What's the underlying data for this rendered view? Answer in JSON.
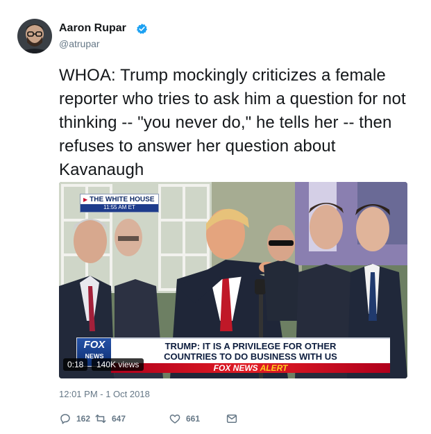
{
  "author": {
    "name": "Aaron Rupar",
    "handle": "@atrupar",
    "verified": true
  },
  "tweet": {
    "text": "WHOA: Trump mockingly criticizes a female reporter who tries to ask him a question for not thinking -- \"you never do,\" he tells her -- then refuses to answer her question about Kavanaugh",
    "timestamp": "12:01 PM - 1 Oct 2018"
  },
  "video": {
    "badge_title": "THE WHITE HOUSE",
    "badge_time": "11:55 AM ET",
    "logo_text": "FOX",
    "logo_sub": "NEWS",
    "headline_line1": "TRUMP: IT IS A PRIVILEGE FOR OTHER",
    "headline_line2": "COUNTRIES TO DO BUSINESS WITH US",
    "alert_brand": "FOX NEWS",
    "alert_word": "ALERT",
    "duration": "0:18",
    "views": "140K views"
  },
  "actions": {
    "replies": "162",
    "retweets": "647",
    "likes": "661"
  },
  "icons": {
    "verified": "verified-badge-icon",
    "reply": "reply-icon",
    "retweet": "retweet-icon",
    "like": "heart-icon",
    "dm": "direct-message-icon"
  },
  "colors": {
    "verified": "#1da1f2",
    "muted": "#657786",
    "text": "#14171a",
    "alert_red": "#d8141f"
  }
}
